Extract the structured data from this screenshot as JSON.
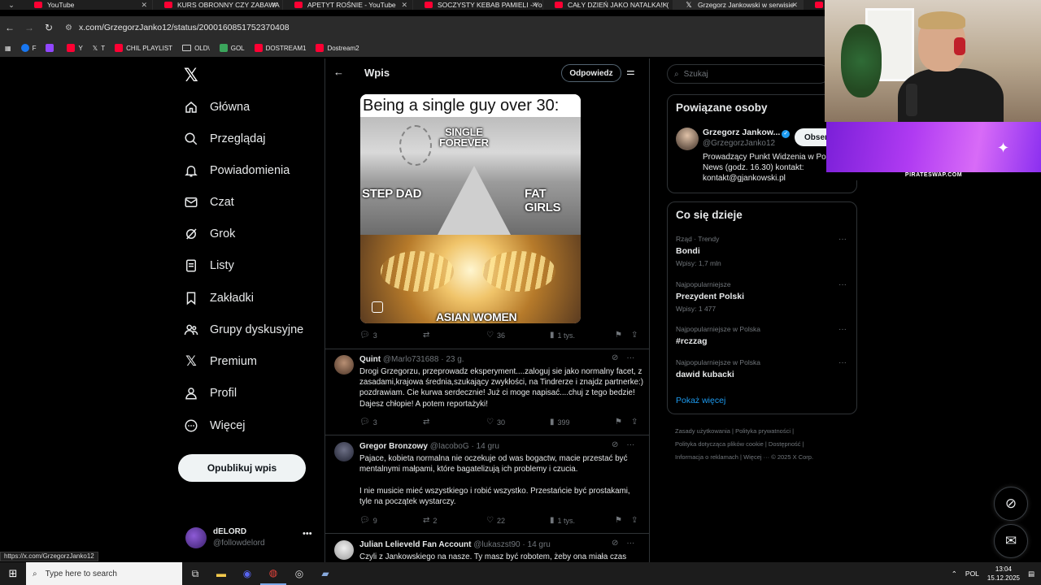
{
  "browser": {
    "tabs": [
      {
        "title": "YouTube",
        "active": false
      },
      {
        "title": "KURS OBRONNY CZY ZABAWA",
        "active": false
      },
      {
        "title": "APETYT ROŚNIE - YouTube",
        "active": false
      },
      {
        "title": "SOCZYSTY KEBAB PAMIELI - Yo",
        "active": false
      },
      {
        "title": "CAŁY DZIEŃ JAKO NATALKA!! (",
        "active": false
      },
      {
        "title": "Grzegorz Jankowski w serwisie",
        "active": true
      },
      {
        "title": "Gw",
        "active": false
      }
    ],
    "url": "x.com/GrzegorzJanko12/status/2000160851752370408",
    "bookmarks": [
      "F",
      "",
      "Y",
      "T",
      "CHIL PLAYLIST",
      "OLD\\",
      "GOL",
      "DOSTREAM1",
      "Dostream2"
    ],
    "status_url": "https://x.com/GrzegorzJanko12"
  },
  "sidebar": {
    "logo": "X",
    "items": [
      {
        "label": "Główna",
        "icon": "home-icon"
      },
      {
        "label": "Przeglądaj",
        "icon": "search-icon"
      },
      {
        "label": "Powiadomienia",
        "icon": "bell-icon"
      },
      {
        "label": "Czat",
        "icon": "mail-icon"
      },
      {
        "label": "Grok",
        "icon": "grok-icon"
      },
      {
        "label": "Listy",
        "icon": "list-icon"
      },
      {
        "label": "Zakładki",
        "icon": "bookmark-icon"
      },
      {
        "label": "Grupy dyskusyjne",
        "icon": "people-icon"
      },
      {
        "label": "Premium",
        "icon": "x-icon"
      },
      {
        "label": "Profil",
        "icon": "person-icon"
      },
      {
        "label": "Więcej",
        "icon": "more-icon"
      }
    ],
    "post_button": "Opublikuj wpis",
    "account": {
      "name": "dELORD",
      "handle": "@followdelord"
    }
  },
  "main": {
    "title": "Wpis",
    "reply_button": "Odpowiedz",
    "meme": {
      "top_text": "Being a single guy over 30:",
      "label_single": "SINGLE\nFOREVER",
      "label_stepdad": "STEP DAD",
      "label_fatgirls": "FAT GIRLS",
      "label_asian": "ASIAN WOMEN"
    },
    "post_actions": {
      "replies": "3",
      "reposts": "",
      "likes": "36",
      "views": "1 tys."
    },
    "replies": [
      {
        "name": "Quint",
        "handle": "@Marlo731688",
        "time": "23 g.",
        "text": "Drogi Grzegorzu, przeprowadz eksperyment....zaloguj sie jako normalny facet, z zasadami,krajowa średnia,szukający zwykłości, na Tindrerze i znajdz partnerke:) pozdrawiam. Cie kurwa serdecznie! Już ci moge napisać....chuj z tego bedzie! Dajesz chłopie! A potem reportażyki!",
        "replies": "3",
        "reposts": "",
        "likes": "30",
        "views": "399",
        "avatar_color": "#7a5a48"
      },
      {
        "name": "Gregor Bronzowy",
        "handle": "@IacoboG",
        "time": "14 gru",
        "text": "Pajace, kobieta normalna nie oczekuje od was bogactw, macie przestać być mentalnymi małpami, które bagatelizują ich problemy i czucia.\n\nI nie musicie mieć wszystkiego i robić wszystko. Przestańcie być prostakami, tyle na początek wystarczy.",
        "replies": "9",
        "reposts": "2",
        "likes": "22",
        "views": "1 tys.",
        "avatar_color": "#3a3d4a"
      },
      {
        "name": "Julian Lelieveld Fan Account",
        "handle": "@lukaszst90",
        "time": "14 gru",
        "text": "Czyli z Jankowskiego na nasze. Ty masz być robotem, żeby ona miała czas",
        "avatar_color": "#c9c9c9"
      }
    ]
  },
  "right": {
    "search_placeholder": "Szukaj",
    "related": {
      "title": "Powiązane osoby",
      "name": "Grzegorz Jankow...",
      "handle": "@GrzegorzJanko12",
      "bio": "Prowadzący Punkt Widzenia w Po News (godz. 16.30) kontakt: kontakt@gjankowski.pl",
      "follow": "Obser"
    },
    "trends": {
      "title": "Co się dzieje",
      "items": [
        {
          "context": "Rząd · Trendy",
          "topic": "Bondi",
          "count": "Wpisy: 1,7 mln"
        },
        {
          "context": "Najpopularniejsze",
          "topic": "Prezydent Polski",
          "count": "Wpisy: 1 477"
        },
        {
          "context": "Najpopularniejsze w Polska",
          "topic": "#rczzag",
          "count": ""
        },
        {
          "context": "Najpopularniejsze w Polska",
          "topic": "dawid kubacki",
          "count": ""
        }
      ],
      "show_more": "Pokaż więcej"
    },
    "footer": "Zasady użytkowania  |  Polityka prywatności  |\nPolityka dotycząca plików cookie  |  Dostępność  |\nInformacja o reklamach  |  Więcej ···  © 2025 X Corp."
  },
  "overlay": {
    "promo_label": "PIRATESWAP.COM"
  },
  "taskbar": {
    "search_placeholder": "Type here to search",
    "lang": "POL",
    "time": "13:04",
    "date": "15.12.2025"
  }
}
